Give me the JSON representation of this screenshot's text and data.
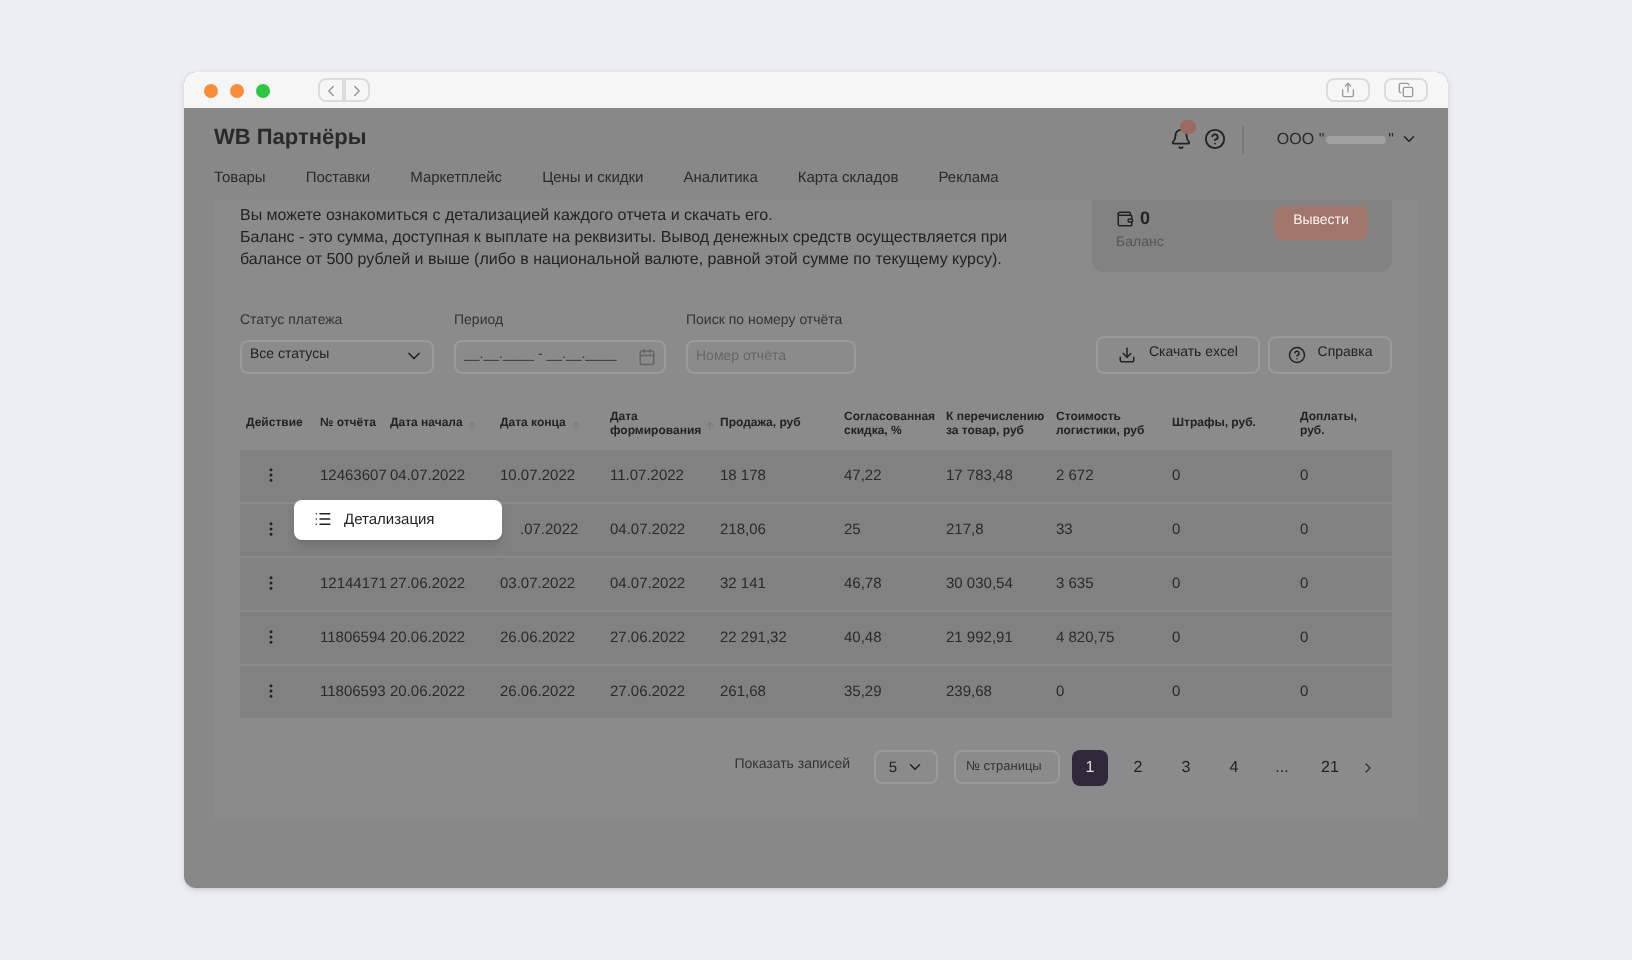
{
  "app": {
    "title": "WB Партнёры",
    "company_prefix": "ООО \"",
    "company_suffix": "\""
  },
  "nav": [
    {
      "label": "Товары",
      "selected": false
    },
    {
      "label": "Поставки",
      "selected": false
    },
    {
      "label": "Маркетплейс",
      "selected": false
    },
    {
      "label": "Цены и скидки",
      "selected": false
    },
    {
      "label": "Аналитика",
      "selected": false
    },
    {
      "label": "Карта складов",
      "selected": false
    },
    {
      "label": "Реклама",
      "selected": false
    }
  ],
  "intro": [
    "Вы можете ознакомиться с детализацией каждого отчета и скачать его.",
    "Баланс - это сумма, доступная к выплате на реквизиты. Вывод денежных средств осуществляется при балансе от 500 рублей и выше (либо в национальной валюте, равной этой сумме по текущему курсу)."
  ],
  "balance": {
    "value": "0",
    "label": "Баланс",
    "button": "Вывести"
  },
  "filters": {
    "status": {
      "label": "Статус платежа",
      "value": "Все статусы"
    },
    "period": {
      "label": "Период",
      "placeholder": "__.__.____ - __.__.____"
    },
    "search": {
      "label": "Поиск по номеру отчёта",
      "placeholder": "Номер отчёта"
    }
  },
  "actions": [
    "Скачать excel",
    "Справка"
  ],
  "table": {
    "columns": [
      {
        "label": "Действие",
        "sortable": false
      },
      {
        "label": "№ отчёта",
        "sortable": false
      },
      {
        "label": "Дата начала",
        "sortable": true
      },
      {
        "label": "Дата конца",
        "sortable": true
      },
      {
        "label": "Дата формирования",
        "sortable": true
      },
      {
        "label": "Продажа, руб",
        "sortable": false
      },
      {
        "label": "Согласованная скидка, %",
        "sortable": false
      },
      {
        "label": "К перечислению за товар, руб",
        "sortable": false
      },
      {
        "label": "Стоимость логистики, руб",
        "sortable": false
      },
      {
        "label": "Штрафы, руб.",
        "sortable": false
      },
      {
        "label": "Доплаты, руб.",
        "sortable": false
      }
    ],
    "rows": [
      [
        "",
        "12463607",
        "04.07.2022",
        "10.07.2022",
        "11.07.2022",
        "18 178",
        "47,22",
        "17 783,48",
        "2 672",
        "0",
        "0"
      ],
      [
        "",
        "",
        "",
        ".07.2022",
        "04.07.2022",
        "218,06",
        "25",
        "217,8",
        "33",
        "0",
        "0"
      ],
      [
        "",
        "12144171",
        "27.06.2022",
        "03.07.2022",
        "04.07.2022",
        "32 141",
        "46,78",
        "30 030,54",
        "3 635",
        "0",
        "0"
      ],
      [
        "",
        "11806594",
        "20.06.2022",
        "26.06.2022",
        "27.06.2022",
        "22 291,32",
        "40,48",
        "21 992,91",
        "4 820,75",
        "0",
        "0"
      ],
      [
        "",
        "11806593",
        "20.06.2022",
        "26.06.2022",
        "27.06.2022",
        "261,68",
        "35,29",
        "239,68",
        "0",
        "0",
        "0"
      ]
    ]
  },
  "popup": {
    "item": "Детализация"
  },
  "pagination": {
    "label": "Показать записей",
    "page_size": "5",
    "page_placeholder": "№ страницы",
    "pages": [
      {
        "label": "1",
        "selected": true
      },
      {
        "label": "2",
        "selected": false
      },
      {
        "label": "3",
        "selected": false
      },
      {
        "label": "4",
        "selected": false
      },
      {
        "label": "...",
        "selected": false
      },
      {
        "label": "21",
        "selected": false
      }
    ]
  }
}
